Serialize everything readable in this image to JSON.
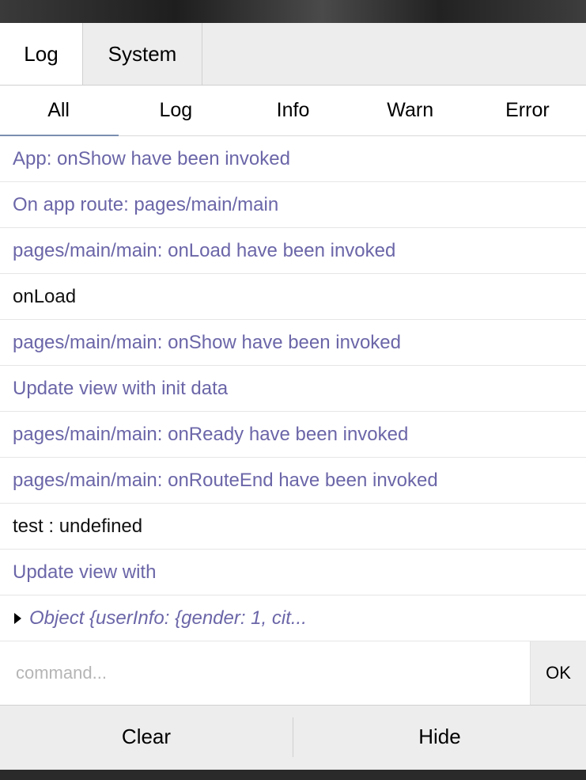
{
  "top_tabs": [
    {
      "label": "Log",
      "active": true
    },
    {
      "label": "System",
      "active": false
    }
  ],
  "filter_tabs": [
    {
      "label": "All",
      "active": true
    },
    {
      "label": "Log",
      "active": false
    },
    {
      "label": "Info",
      "active": false
    },
    {
      "label": "Warn",
      "active": false
    },
    {
      "label": "Error",
      "active": false
    }
  ],
  "log_entries": [
    {
      "text": "App: onShow have been invoked",
      "kind": "system"
    },
    {
      "text": "On app route: pages/main/main",
      "kind": "system"
    },
    {
      "text": "pages/main/main: onLoad have been invoked",
      "kind": "system"
    },
    {
      "text": "onLoad",
      "kind": "log"
    },
    {
      "text": "pages/main/main: onShow have been invoked",
      "kind": "system"
    },
    {
      "text": "Update view with init data",
      "kind": "system"
    },
    {
      "text": "pages/main/main: onReady have been invoked",
      "kind": "system"
    },
    {
      "text": "pages/main/main: onRouteEnd have been invoked",
      "kind": "system"
    },
    {
      "text": "test : undefined",
      "kind": "log"
    },
    {
      "text": "Update view with",
      "kind": "system"
    },
    {
      "text": "Object {userInfo: {gender: 1, cit...",
      "kind": "object"
    }
  ],
  "command": {
    "placeholder": "command...",
    "value": "",
    "ok_label": "OK"
  },
  "footer": {
    "clear_label": "Clear",
    "hide_label": "Hide"
  },
  "colors": {
    "system_text": "#6b66a8",
    "log_text": "#111111",
    "active_underline": "#7a8fb0"
  }
}
